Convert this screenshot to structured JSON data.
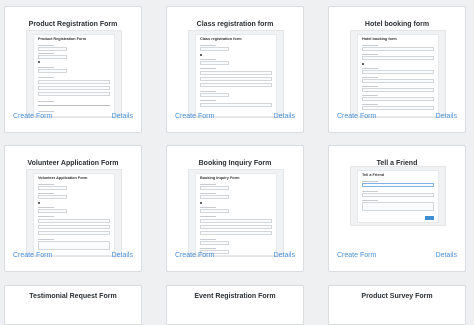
{
  "cards": [
    {
      "title": "Product Registration Form",
      "preview_title": "Product Registration Form",
      "create_label": "Create Form",
      "details_label": "Details"
    },
    {
      "title": "Class registration form",
      "preview_title": "Class registration form",
      "create_label": "Create Form",
      "details_label": "Details"
    },
    {
      "title": "Hotel booking form",
      "preview_title": "Hotel booking form",
      "create_label": "Create Form",
      "details_label": "Details"
    },
    {
      "title": "Volunteer Application Form",
      "preview_title": "Volunteer Application Form",
      "create_label": "Create Form",
      "details_label": "Details"
    },
    {
      "title": "Booking Inquiry Form",
      "preview_title": "Booking Inquiry Form",
      "create_label": "Create Form",
      "details_label": "Details"
    },
    {
      "title": "Tell a Friend",
      "preview_title": "Tell a Friend",
      "create_label": "Create Form",
      "details_label": "Details"
    },
    {
      "title": "Testimonial Request Form"
    },
    {
      "title": "Event Registration Form"
    },
    {
      "title": "Product Survey Form"
    }
  ],
  "colors": {
    "link": "#4a90d9",
    "accent_button": "#3b8fd2",
    "card_bg": "#ffffff",
    "page_bg": "#eef0f2"
  }
}
